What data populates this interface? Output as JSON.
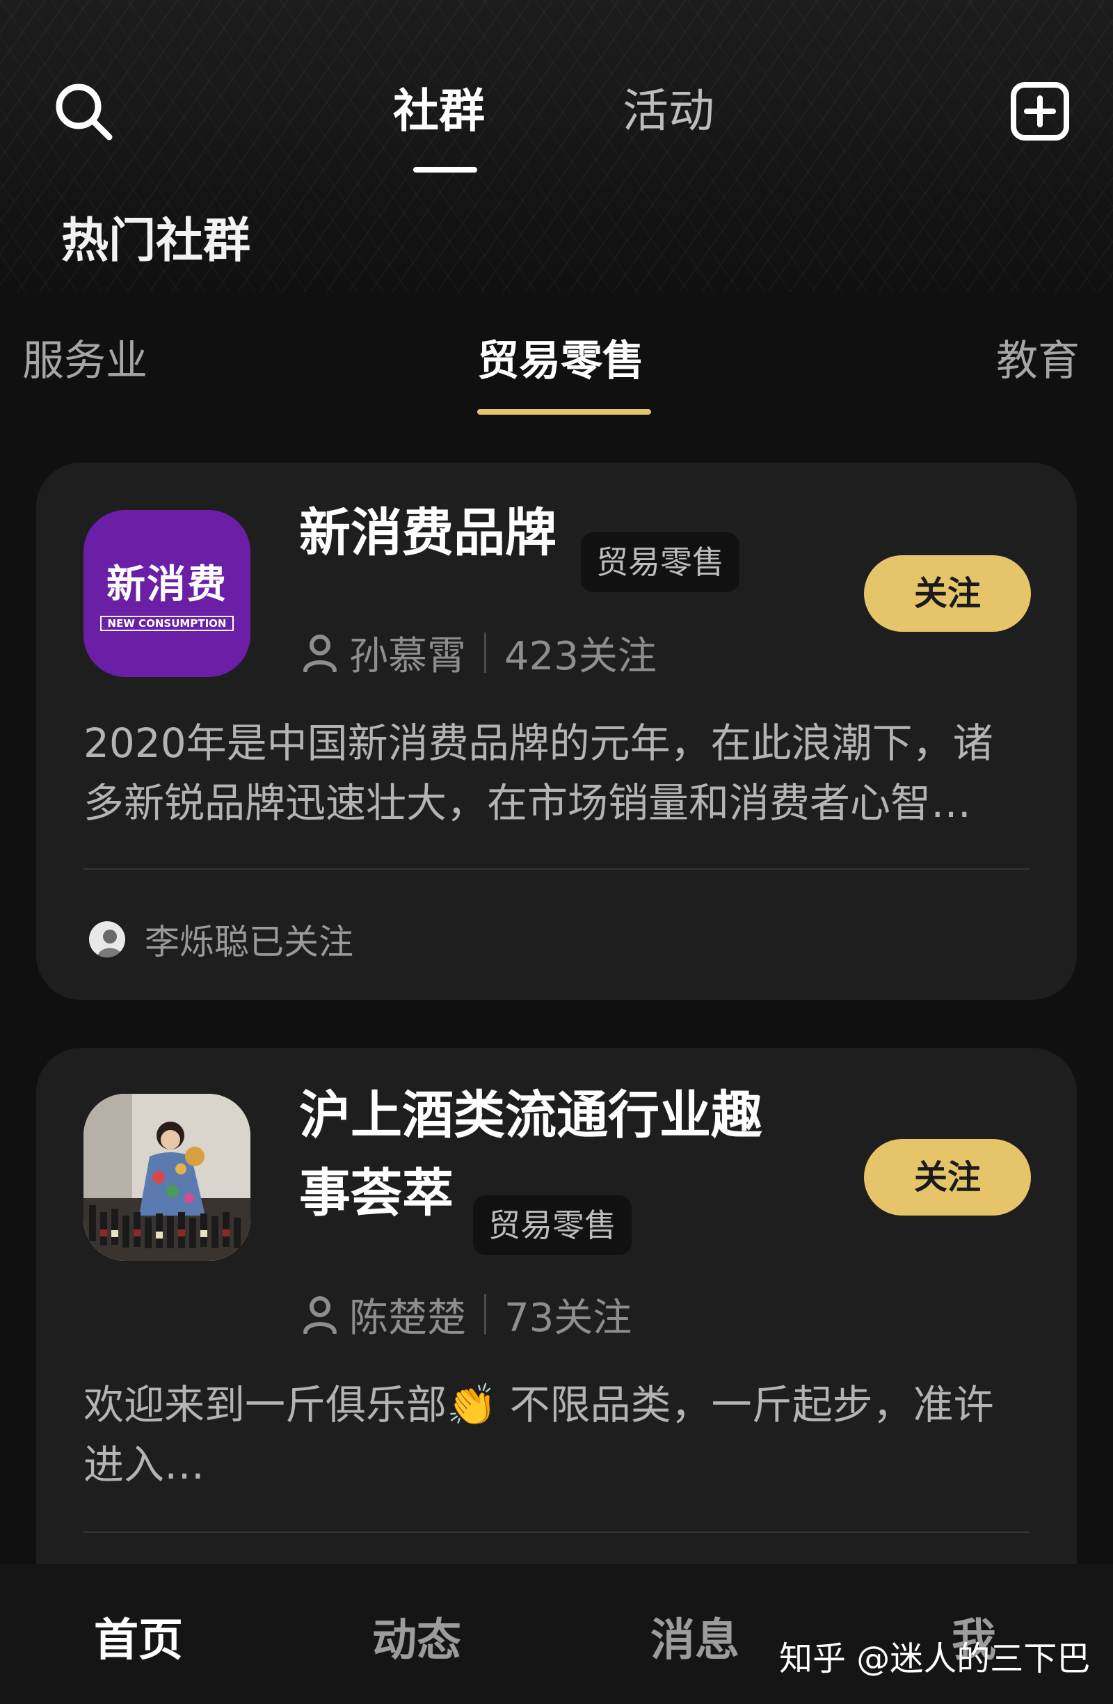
{
  "top_tabs": [
    {
      "label": "社群",
      "active": true
    },
    {
      "label": "活动",
      "active": false
    }
  ],
  "icons": {
    "search": "search-icon",
    "add": "add-square-icon",
    "user": "user-icon"
  },
  "section_title": "热门社群",
  "category_tabs": [
    {
      "label": "服务业",
      "active": false
    },
    {
      "label": "贸易零售",
      "active": true
    },
    {
      "label": "教育",
      "active": false
    }
  ],
  "accent_color": "#e6c56a",
  "cards": [
    {
      "logo_text": "新消费",
      "logo_subtext": "NEW CONSUMPTION",
      "name": "新消费品牌",
      "tag": "贸易零售",
      "follow_label": "关注",
      "owner": "孙慕霄",
      "followers": "423关注",
      "description_line1": "2020年是中国新消费品牌的元年，在此浪潮下，诸",
      "description_line2": "多新锐品牌迅速壮大，在市场销量和消费者心智…",
      "followed_by": "李烁聪已关注"
    },
    {
      "name_line1": "沪上酒类流通行业趣",
      "name_line2": "事荟萃",
      "tag": "贸易零售",
      "follow_label": "关注",
      "owner": "陈楚楚",
      "followers": "73关注",
      "description_line1": "欢迎来到一斤俱乐部👏 不限品类，一斤起步，准许",
      "description_line2": "进入…"
    }
  ],
  "bottom_nav": [
    {
      "label": "首页",
      "active": true
    },
    {
      "label": "动态",
      "active": false
    },
    {
      "label": "消息",
      "active": false
    },
    {
      "label": "我",
      "active": false
    }
  ],
  "watermark": "知乎 @迷人的三下巴"
}
